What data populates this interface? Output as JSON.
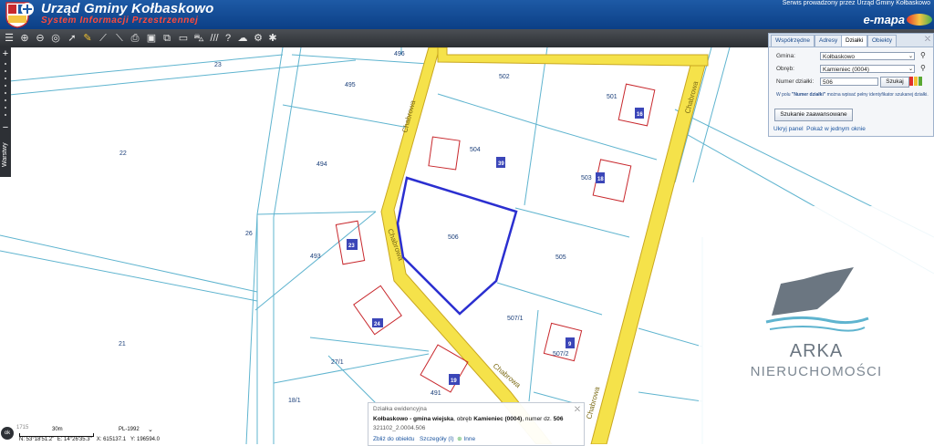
{
  "header": {
    "title": "Urząd Gminy Kołbaskowo",
    "subtitle": "System Informacji Przestrzennej",
    "service_note": "Serwis prowadzony przez Urząd Gminy Kołbaskowo",
    "emapa": "e-mapa",
    "colors": {
      "bar": "#0b3f86",
      "subtitle": "#ff4a3a"
    }
  },
  "toolbar": {
    "icons": [
      "layers-icon",
      "zoom-in-icon",
      "zoom-out-icon",
      "zoom-extent-icon",
      "pointer-icon",
      "pencil-icon",
      "measure-icon",
      "ruler-icon",
      "print-icon",
      "bookmark-icon",
      "export-icon",
      "sketch-icon",
      "car-icon",
      "bus-icon",
      "hatch-icon",
      "help-icon",
      "cloud-icon",
      "settings-icon",
      "tools-icon"
    ]
  },
  "left_bar": {
    "zoom_in": "+",
    "zoom_out": "−",
    "layers_tab": "Warstwy"
  },
  "map": {
    "parcels": [
      "23",
      "496",
      "495",
      "502",
      "501",
      "22",
      "494",
      "504",
      "503",
      "506",
      "26",
      "493",
      "505",
      "507/1",
      "21",
      "27/1",
      "507/2",
      "18/1",
      "491"
    ],
    "streets": [
      "Chabrowa",
      "Chabrowa",
      "Chabrowa",
      "Chabrowa",
      "Chabrowa"
    ],
    "buildings": [
      "16",
      "39",
      "18",
      "23",
      "24",
      "9",
      "19"
    ],
    "colors": {
      "parcel_line": "#5fb4cf",
      "street_fill": "#f5e24a",
      "street_edge": "#c9a720",
      "building": "#c8282d",
      "selection": "#2b2fd0",
      "label": "#1b3f7a"
    }
  },
  "panel": {
    "tabs": [
      "Współrzędne",
      "Adresy",
      "Działki",
      "Obiekty"
    ],
    "active_tab": "Działki",
    "gmina_label": "Gmina:",
    "gmina_value": "Kołbaskowo",
    "obreb_label": "Obręb:",
    "obreb_value": "Kamieniec (0004)",
    "numer_label": "Numer działki:",
    "numer_value": "506",
    "search_button": "Szukaj",
    "hint_prefix": "W polu ",
    "hint_field": "\"Numer działki\"",
    "hint_suffix": " można wpisać pełny identyfikator szukanej działki.",
    "advanced_button": "Szukanie zaawansowane",
    "hide_link": "Ukryj panel",
    "window_link": "Pokaż w jednym oknie"
  },
  "info": {
    "heading": "Działka ewidencyjna",
    "gmina": "Kołbaskowo - gmina wiejska",
    "obreb_label": ", obręb ",
    "obreb": "Kamieniec (0004)",
    "numer_label": ", numer dz. ",
    "numer": "506",
    "identifier": "321102_2.0004.506",
    "zoom_link": "Zbliż do obiektu",
    "details_link": "Szczegóły (I)",
    "other_link": "Inne"
  },
  "status": {
    "scale_left": "1715",
    "scale_label": "30m",
    "crs": "PL-1992",
    "coords": "N: 53°18'51.2\"  E: 14°26'35.3\"   X: 615137.1   Y: 196594.0",
    "ok_badge": "ok"
  },
  "watermark": {
    "title": "ARKA",
    "subtitle": "NIERUCHOMOŚCI"
  }
}
